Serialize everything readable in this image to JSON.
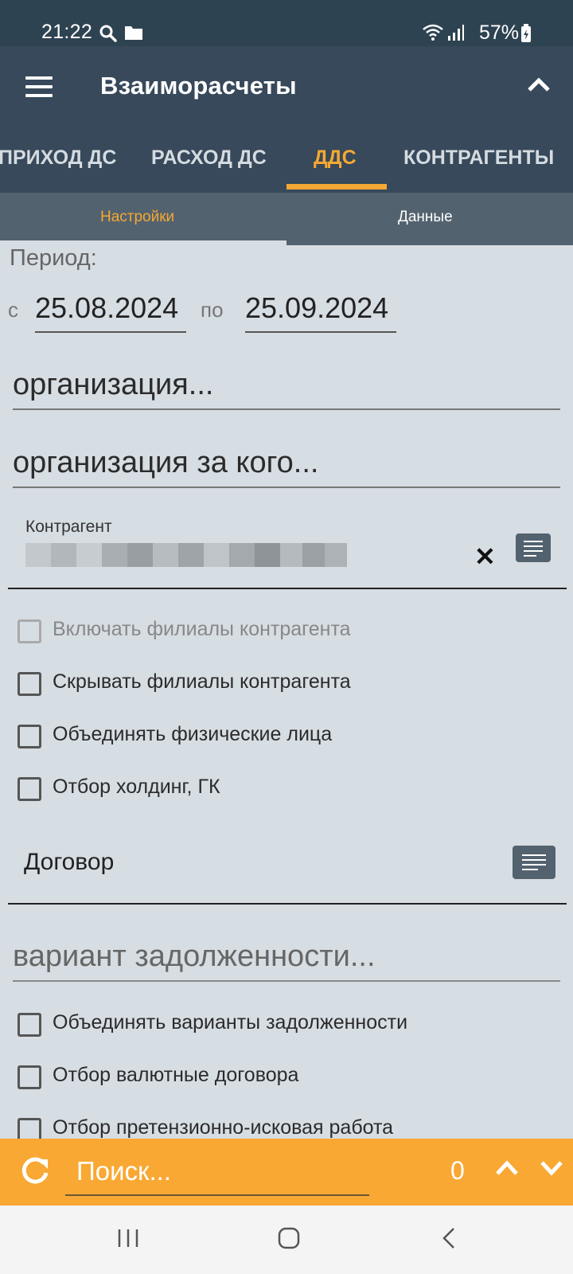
{
  "status_bar": {
    "time": "21:22",
    "battery": "57%"
  },
  "app_bar": {
    "title": "Взаиморасчеты"
  },
  "main_tabs": [
    {
      "label": "ПРИХОД ДС",
      "active": false
    },
    {
      "label": "РАСХОД ДС",
      "active": false
    },
    {
      "label": "ДДС",
      "active": true
    },
    {
      "label": "КОНТРАГЕНТЫ",
      "active": false
    }
  ],
  "sub_tabs": [
    {
      "label": "Настройки",
      "active": true
    },
    {
      "label": "Данные",
      "active": false
    }
  ],
  "form": {
    "period_label": "Период:",
    "from_label": "с",
    "date_from": "25.08.2024",
    "to_label": "по",
    "date_to": "25.09.2024",
    "organization": "организация...",
    "organization_for": "организация за кого...",
    "contractor_label": "Контрагент",
    "contract_label": "Договор",
    "debt_variant": "вариант задолженности..."
  },
  "checkboxes_group1": [
    {
      "label": "Включать филиалы контрагента",
      "checked": false,
      "disabled": true
    },
    {
      "label": "Скрывать филиалы контрагента",
      "checked": false,
      "disabled": false
    },
    {
      "label": "Объединять физические лица",
      "checked": false,
      "disabled": false
    },
    {
      "label": "Отбор холдинг, ГК",
      "checked": false,
      "disabled": false
    }
  ],
  "checkboxes_group2": [
    {
      "label": "Объединять варианты задолженности",
      "checked": false
    },
    {
      "label": "Отбор валютные договора",
      "checked": false
    },
    {
      "label": "Отбор претензионно-исковая работа",
      "checked": false
    }
  ],
  "search": {
    "placeholder": "Поиск...",
    "count": "0"
  },
  "colors": {
    "accent": "#f5a833",
    "app_bar": "#37495a",
    "sub_tabs": "#53626f",
    "background": "#d6dde3"
  },
  "icons": [
    "search-icon",
    "folder-icon",
    "wifi-icon",
    "signal-icon",
    "battery-icon",
    "menu-icon",
    "chevron-up-icon",
    "close-icon",
    "list-icon",
    "refresh-icon",
    "chevron-down-icon",
    "recent-apps-icon",
    "home-icon",
    "back-icon"
  ]
}
